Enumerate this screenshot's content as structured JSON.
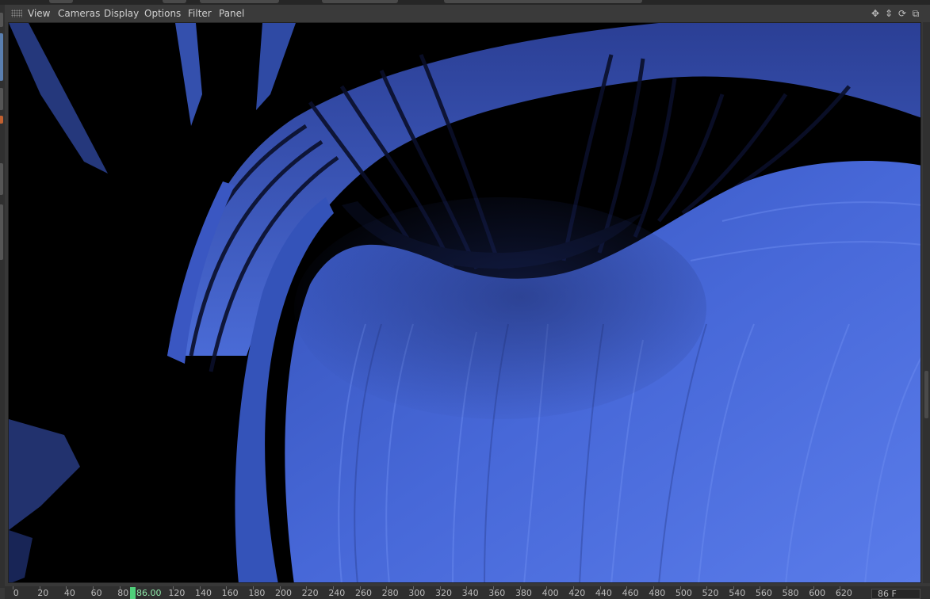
{
  "menubar": {
    "items": [
      "View",
      "Cameras",
      "Display",
      "Options",
      "Filter",
      "Panel"
    ],
    "nav_icons": [
      {
        "name": "move-icon",
        "glyph": "✥"
      },
      {
        "name": "zoom-icon",
        "glyph": "⇕"
      },
      {
        "name": "rotate-icon",
        "glyph": "⟳"
      },
      {
        "name": "toggle-view-icon",
        "glyph": "⧉"
      }
    ]
  },
  "viewport": {
    "content": "3d-render",
    "colors": {
      "background": "#000000",
      "surface_light": "#4a6ee0",
      "surface_mid": "#3a5bc4",
      "surface_dark": "#24378a"
    }
  },
  "timeline": {
    "labels": [
      "0",
      "20",
      "40",
      "60",
      "80",
      "120",
      "140",
      "160",
      "180",
      "200",
      "220",
      "240",
      "260",
      "280",
      "300",
      "320",
      "340",
      "360",
      "380",
      "400",
      "420",
      "440",
      "460",
      "480",
      "500",
      "520",
      "540",
      "560",
      "580",
      "600",
      "620"
    ],
    "current_frame_label": "86.00",
    "frame_field": "86 F",
    "marker_color": "#4fd07a"
  }
}
